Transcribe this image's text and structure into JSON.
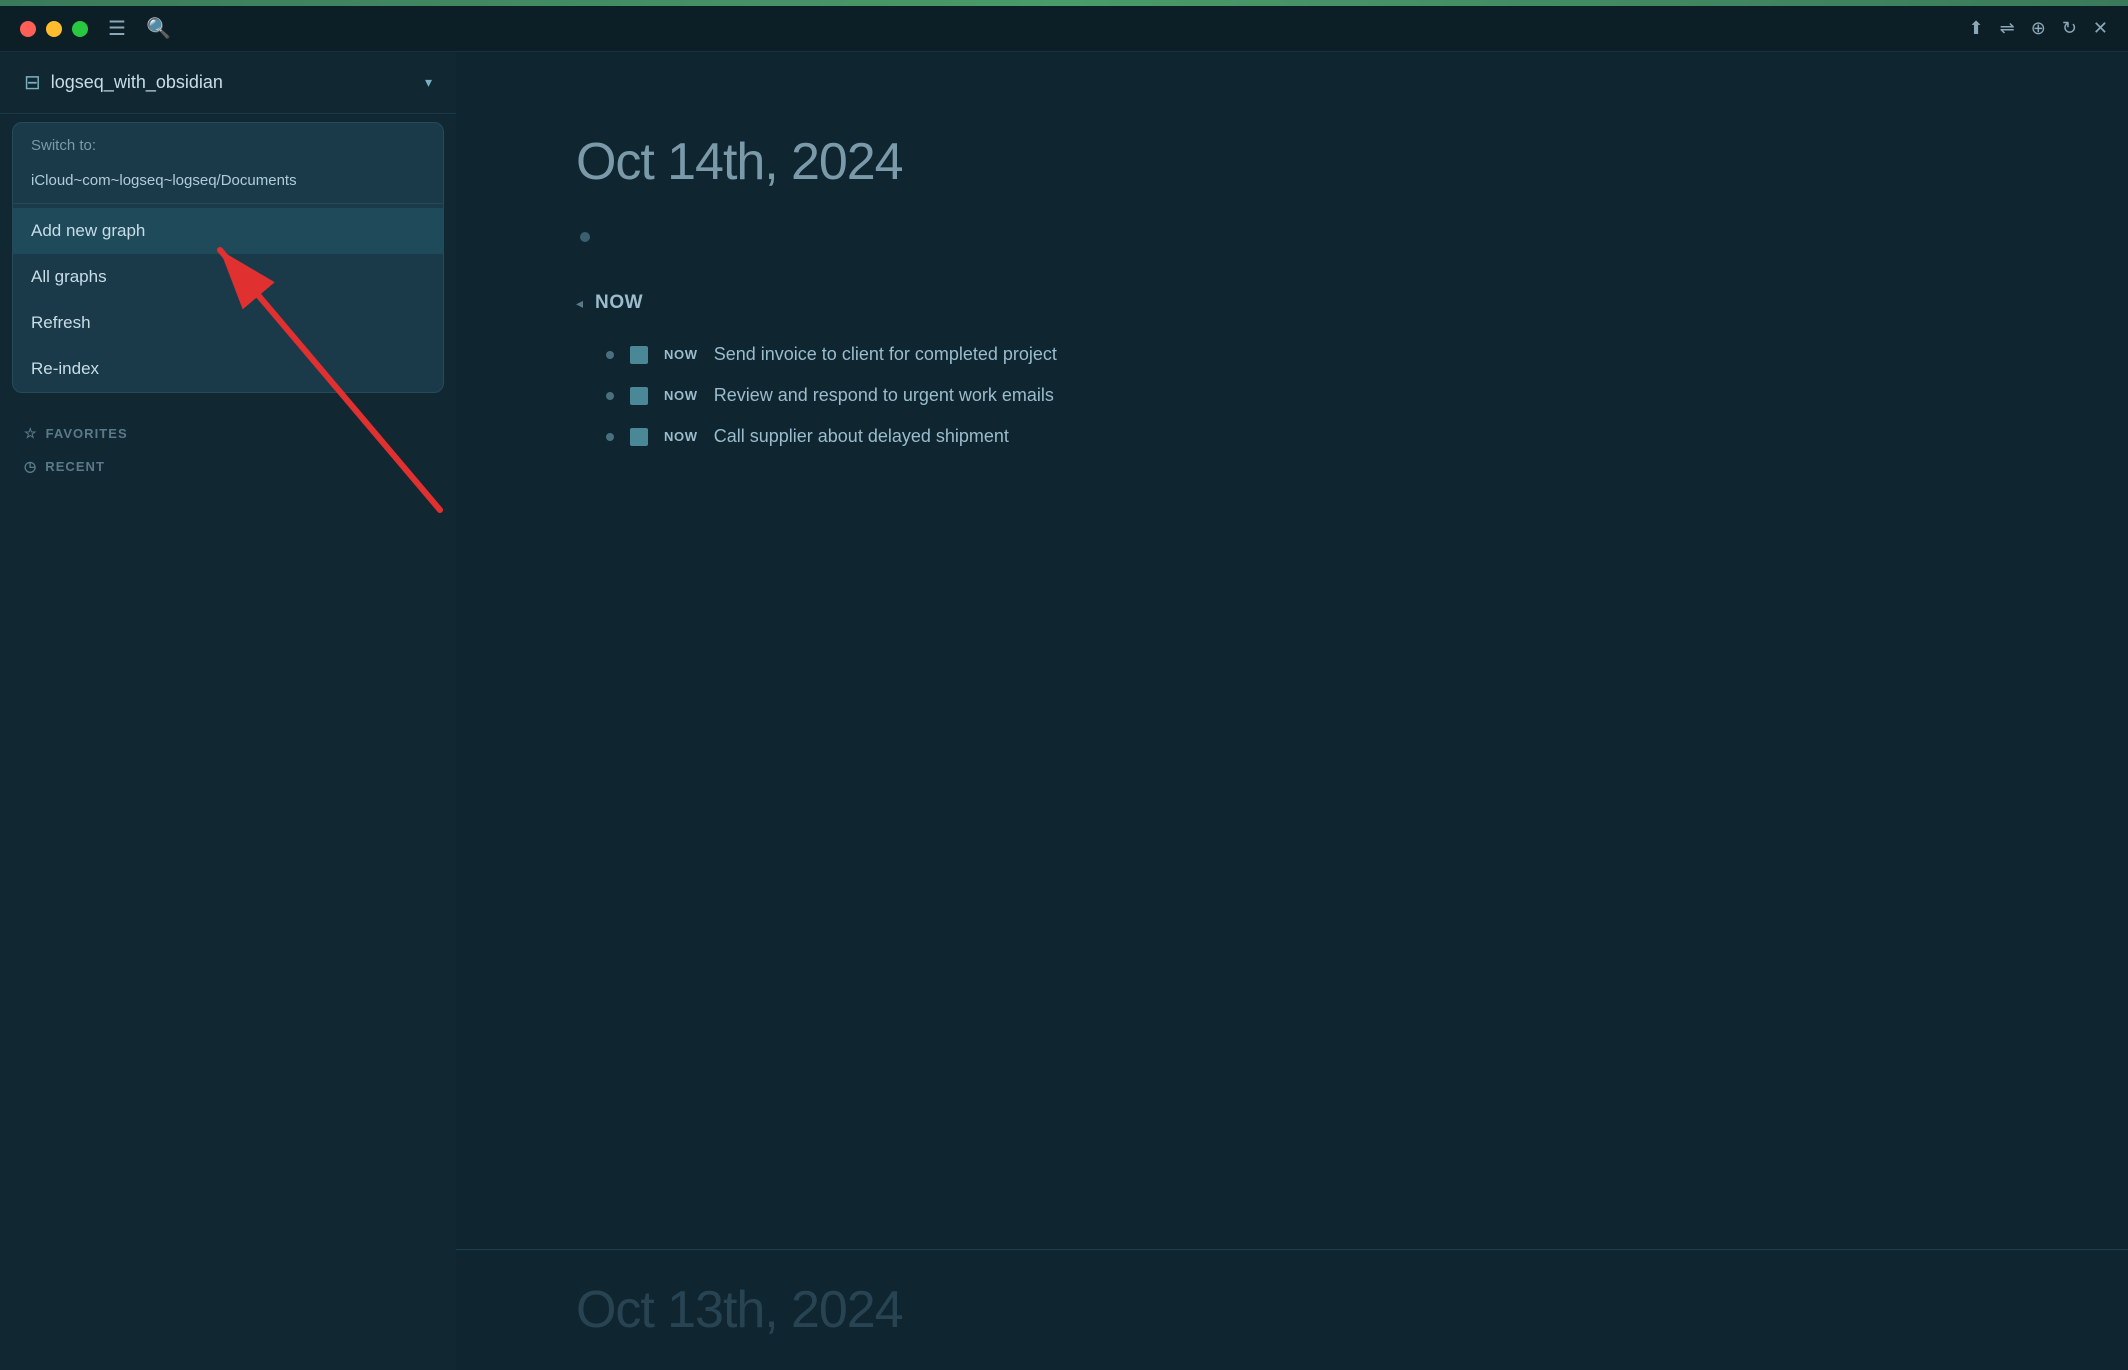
{
  "titlebar": {
    "top_bar_color": "#4a8a5a",
    "hamburger_icon": "☰",
    "search_icon": "🔍"
  },
  "sidebar": {
    "vault_icon": "⊞",
    "vault_name": "logseq_with_obsidian",
    "vault_chevron": "▾",
    "dropdown": {
      "switch_label": "Switch to:",
      "vault_path": "iCloud~com~logseq~logseq/Documents",
      "add_new_graph": "Add new graph",
      "all_graphs": "All graphs",
      "refresh": "Refresh",
      "re_index": "Re-index"
    },
    "sections": {
      "favorites_label": "FAVORITES",
      "recent_label": "RECENT"
    }
  },
  "main": {
    "journal_date": "Oct 14th, 2024",
    "now_header": "NOW",
    "now_items": [
      {
        "badge": "NOW",
        "text": "Send invoice to client for completed project"
      },
      {
        "badge": "NOW",
        "text": "Review and respond to urgent work emails"
      },
      {
        "badge": "NOW",
        "text": "Call supplier about delayed shipment"
      }
    ],
    "next_page_date": "Oct 13th, 2024"
  }
}
